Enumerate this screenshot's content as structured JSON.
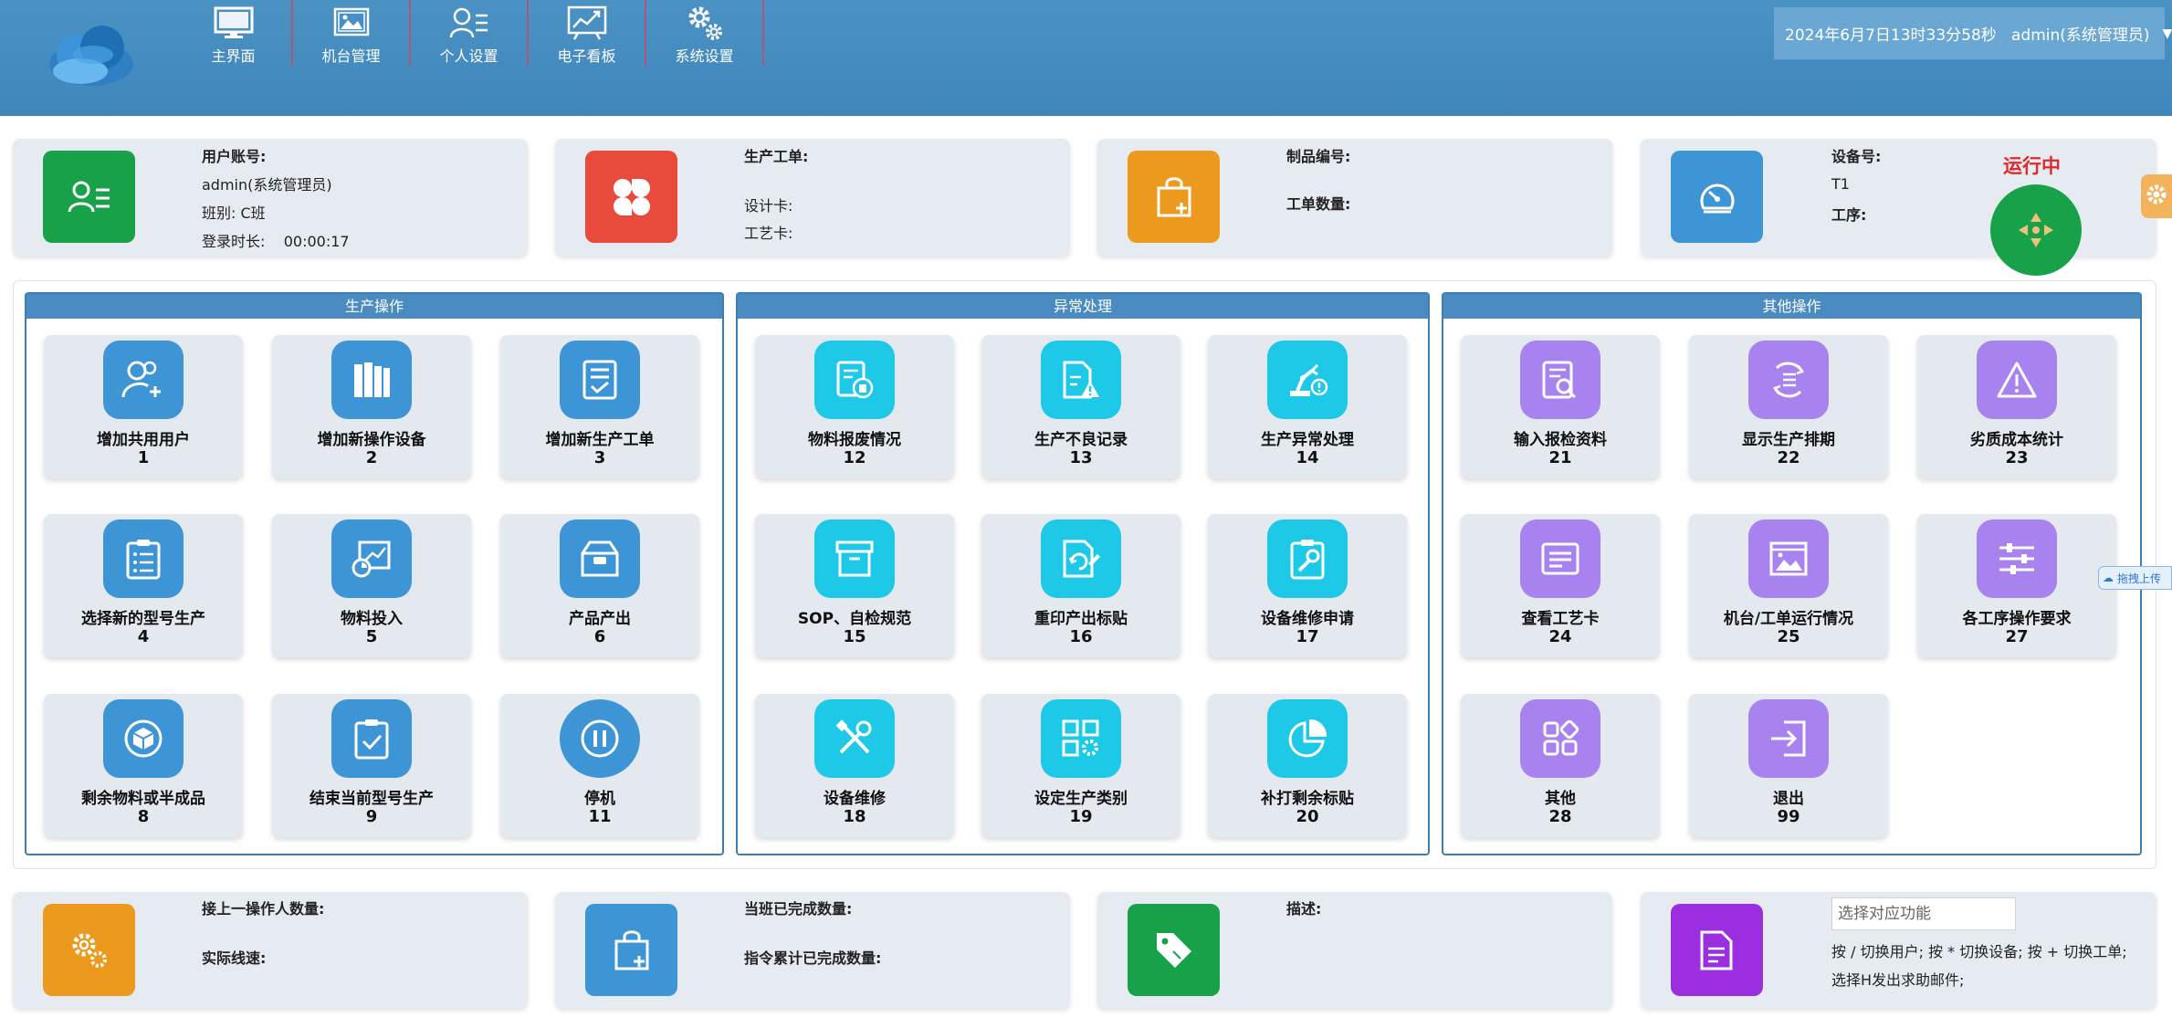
{
  "nav": [
    {
      "label": "主界面",
      "icon": "monitor-icon"
    },
    {
      "label": "机台管理",
      "icon": "image-icon"
    },
    {
      "label": "个人设置",
      "icon": "user-list-icon"
    },
    {
      "label": "电子看板",
      "icon": "chart-board-icon"
    },
    {
      "label": "系统设置",
      "icon": "gears-icon"
    }
  ],
  "user_box": {
    "text": "2024年6月7日13时33分58秒   admin(系统管理员)"
  },
  "info_cards": {
    "user": {
      "account_label": "用户账号:",
      "account_value": "admin(系统管理员)",
      "shift": "班别: C班",
      "login_time": "登录时长:    00:00:17"
    },
    "order": {
      "work_order_label": "生产工单:",
      "design_card_label": "设计卡:",
      "process_card_label": "工艺卡:"
    },
    "product": {
      "product_no_label": "制品编号:",
      "order_qty_label": "工单数量:"
    },
    "device": {
      "device_no_label": "设备号:",
      "device_no_value": "T1",
      "process_label": "工序:",
      "status": "运行中"
    }
  },
  "panels": [
    {
      "title": "生产操作",
      "tiles": [
        {
          "label": "增加共用用户",
          "num": "1",
          "icon": "user-add-icon"
        },
        {
          "label": "增加新操作设备",
          "num": "2",
          "icon": "books-icon"
        },
        {
          "label": "增加新生产工单",
          "num": "3",
          "icon": "doc-check-icon"
        },
        {
          "label": "选择新的型号生产",
          "num": "4",
          "icon": "clipboard-list-icon"
        },
        {
          "label": "物料投入",
          "num": "5",
          "icon": "chart-input-icon"
        },
        {
          "label": "产品产出",
          "num": "6",
          "icon": "box-out-icon"
        },
        {
          "label": "剩余物料或半成品",
          "num": "8",
          "icon": "cube-icon"
        },
        {
          "label": "结束当前型号生产",
          "num": "9",
          "icon": "clipboard-check-icon"
        },
        {
          "label": "停机",
          "num": "11",
          "icon": "pause-icon"
        }
      ]
    },
    {
      "title": "异常处理",
      "tiles": [
        {
          "label": "物料报废情况",
          "num": "12",
          "icon": "doc-trash-icon"
        },
        {
          "label": "生产不良记录",
          "num": "13",
          "icon": "doc-warning-icon"
        },
        {
          "label": "生产异常处理",
          "num": "14",
          "icon": "robot-arm-icon"
        },
        {
          "label": "SOP、自检规范",
          "num": "15",
          "icon": "archive-icon"
        },
        {
          "label": "重印产出标贴",
          "num": "16",
          "icon": "reprint-icon"
        },
        {
          "label": "设备维修申请",
          "num": "17",
          "icon": "wrench-clipboard-icon"
        },
        {
          "label": "设备维修",
          "num": "18",
          "icon": "tools-icon"
        },
        {
          "label": "设定生产类别",
          "num": "19",
          "icon": "grid-gear-icon"
        },
        {
          "label": "补打剩余标贴",
          "num": "20",
          "icon": "pie-icon"
        }
      ]
    },
    {
      "title": "其他操作",
      "tiles": [
        {
          "label": "输入报检资料",
          "num": "21",
          "icon": "doc-search-icon"
        },
        {
          "label": "显示生产排期",
          "num": "22",
          "icon": "schedule-icon"
        },
        {
          "label": "劣质成本统计",
          "num": "23",
          "icon": "warning-icon"
        },
        {
          "label": "查看工艺卡",
          "num": "24",
          "icon": "card-icon"
        },
        {
          "label": "机台/工单运行情况",
          "num": "25",
          "icon": "window-image-icon"
        },
        {
          "label": "各工序操作要求",
          "num": "27",
          "icon": "sliders-icon"
        },
        {
          "label": "其他",
          "num": "28",
          "icon": "apps-icon"
        },
        {
          "label": "退出",
          "num": "99",
          "icon": "exit-icon"
        }
      ]
    }
  ],
  "bottom_cards": {
    "prev_operator": {
      "prev_qty_label": "接上一操作人数量:",
      "line_speed_label": "实际线速:"
    },
    "shift_done": {
      "shift_done_label": "当班已完成数量:",
      "order_done_label": "指令累计已完成数量:"
    },
    "description": {
      "desc_label": "描述:"
    },
    "function": {
      "placeholder": "选择对应功能",
      "hint1": "按 / 切换用户; 按 * 切换设备; 按 + 切换工单;",
      "hint2": "选择H发出求助邮件;"
    }
  },
  "feedback_tab": {
    "label": "拖拽上传"
  },
  "colors": {
    "topbar": "#4289be",
    "green": "#17a24a",
    "red": "#e84a3c",
    "orange": "#eb9a1d",
    "blue": "#3d95d6",
    "cyan": "#1ec9e8",
    "purple": "#a882ee",
    "violet": "#9b2fe0"
  }
}
